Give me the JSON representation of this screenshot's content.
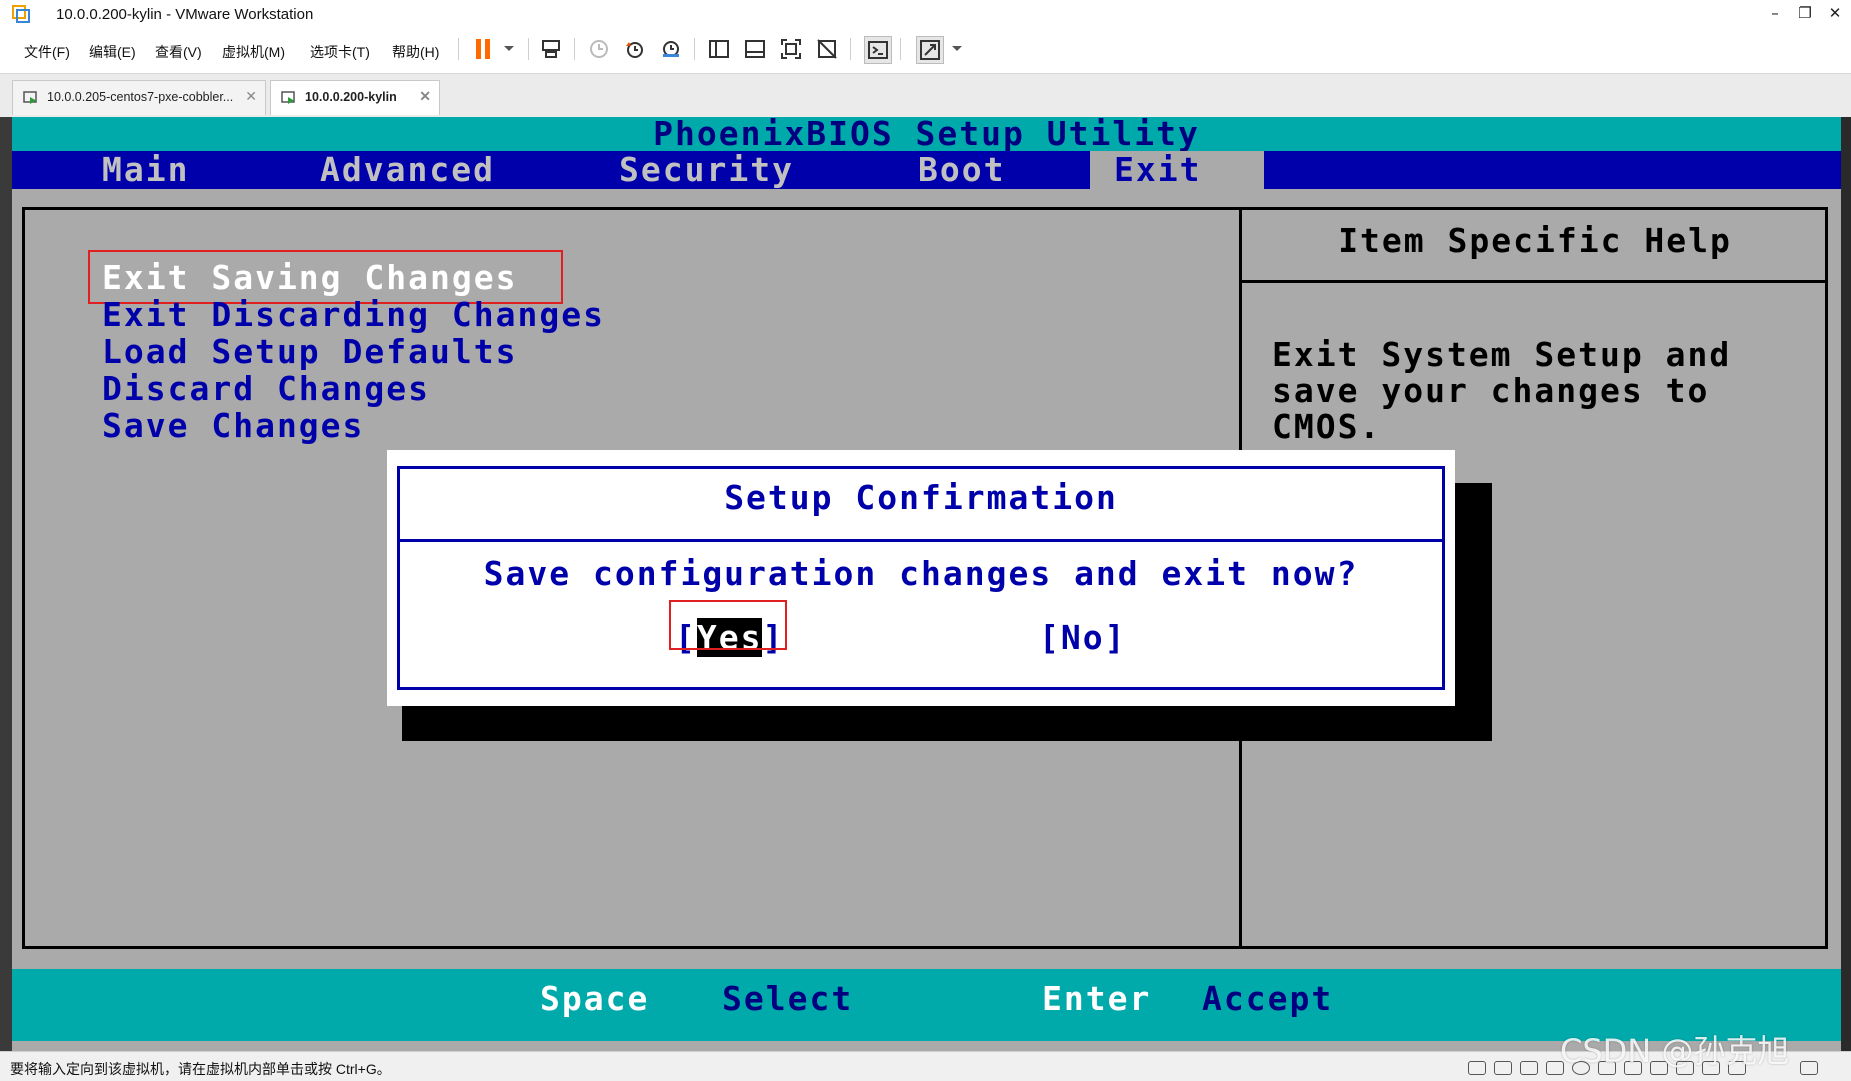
{
  "window": {
    "title": "10.0.0.200-kylin - VMware Workstation",
    "minimize": "–",
    "restore": "❐",
    "close": "✕"
  },
  "menubar": {
    "items": [
      "文件(F)",
      "编辑(E)",
      "查看(V)",
      "虚拟机(M)",
      "选项卡(T)",
      "帮助(H)"
    ]
  },
  "toolbar": {
    "icons": [
      "pause-icon",
      "send-ctrl-alt-del-icon",
      "snapshot-icon",
      "revert-snapshot-icon",
      "snapshot-manager-icon",
      "sidebar-icon",
      "thumbnail-icon",
      "fullscreen-icon",
      "unity-icon",
      "console-icon",
      "stretch-icon"
    ]
  },
  "tabs": [
    {
      "label": "10.0.0.205-centos7-pxe-cobbler...",
      "active": false
    },
    {
      "label": "10.0.0.200-kylin",
      "active": true
    }
  ],
  "bios": {
    "title": "PhoenixBIOS Setup Utility",
    "menus": [
      "Main",
      "Advanced",
      "Security",
      "Boot",
      "Exit"
    ],
    "selected_menu": "Exit",
    "options": [
      "Exit Saving Changes",
      "Exit Discarding Changes",
      "Load Setup Defaults",
      "Discard Changes",
      "Save Changes"
    ],
    "selected_option": "Exit Saving Changes",
    "help_title": "Item Specific Help",
    "help_lines": [
      "Exit System Setup and",
      "save your changes to",
      "CMOS."
    ],
    "footer": [
      {
        "key": "Space",
        "desc": "Select"
      },
      {
        "key": "Enter",
        "desc": "Accept"
      }
    ],
    "colors": {
      "background": "#aaaaaa",
      "menubar": "#0000aa",
      "titlebar": "#00aaaa",
      "text": "#0000aa",
      "highlight": "#ffffff"
    }
  },
  "dialog": {
    "title": "Setup Confirmation",
    "message": "Save configuration changes and exit now?",
    "yes_prefix": "[",
    "yes_label": "Yes",
    "yes_suffix": "]",
    "no_label": "[No]"
  },
  "statusbar": {
    "text": "要将输入定向到该虚拟机，请在虚拟机内部单击或按 Ctrl+G。"
  },
  "watermark": "CSDN @孙克旭"
}
